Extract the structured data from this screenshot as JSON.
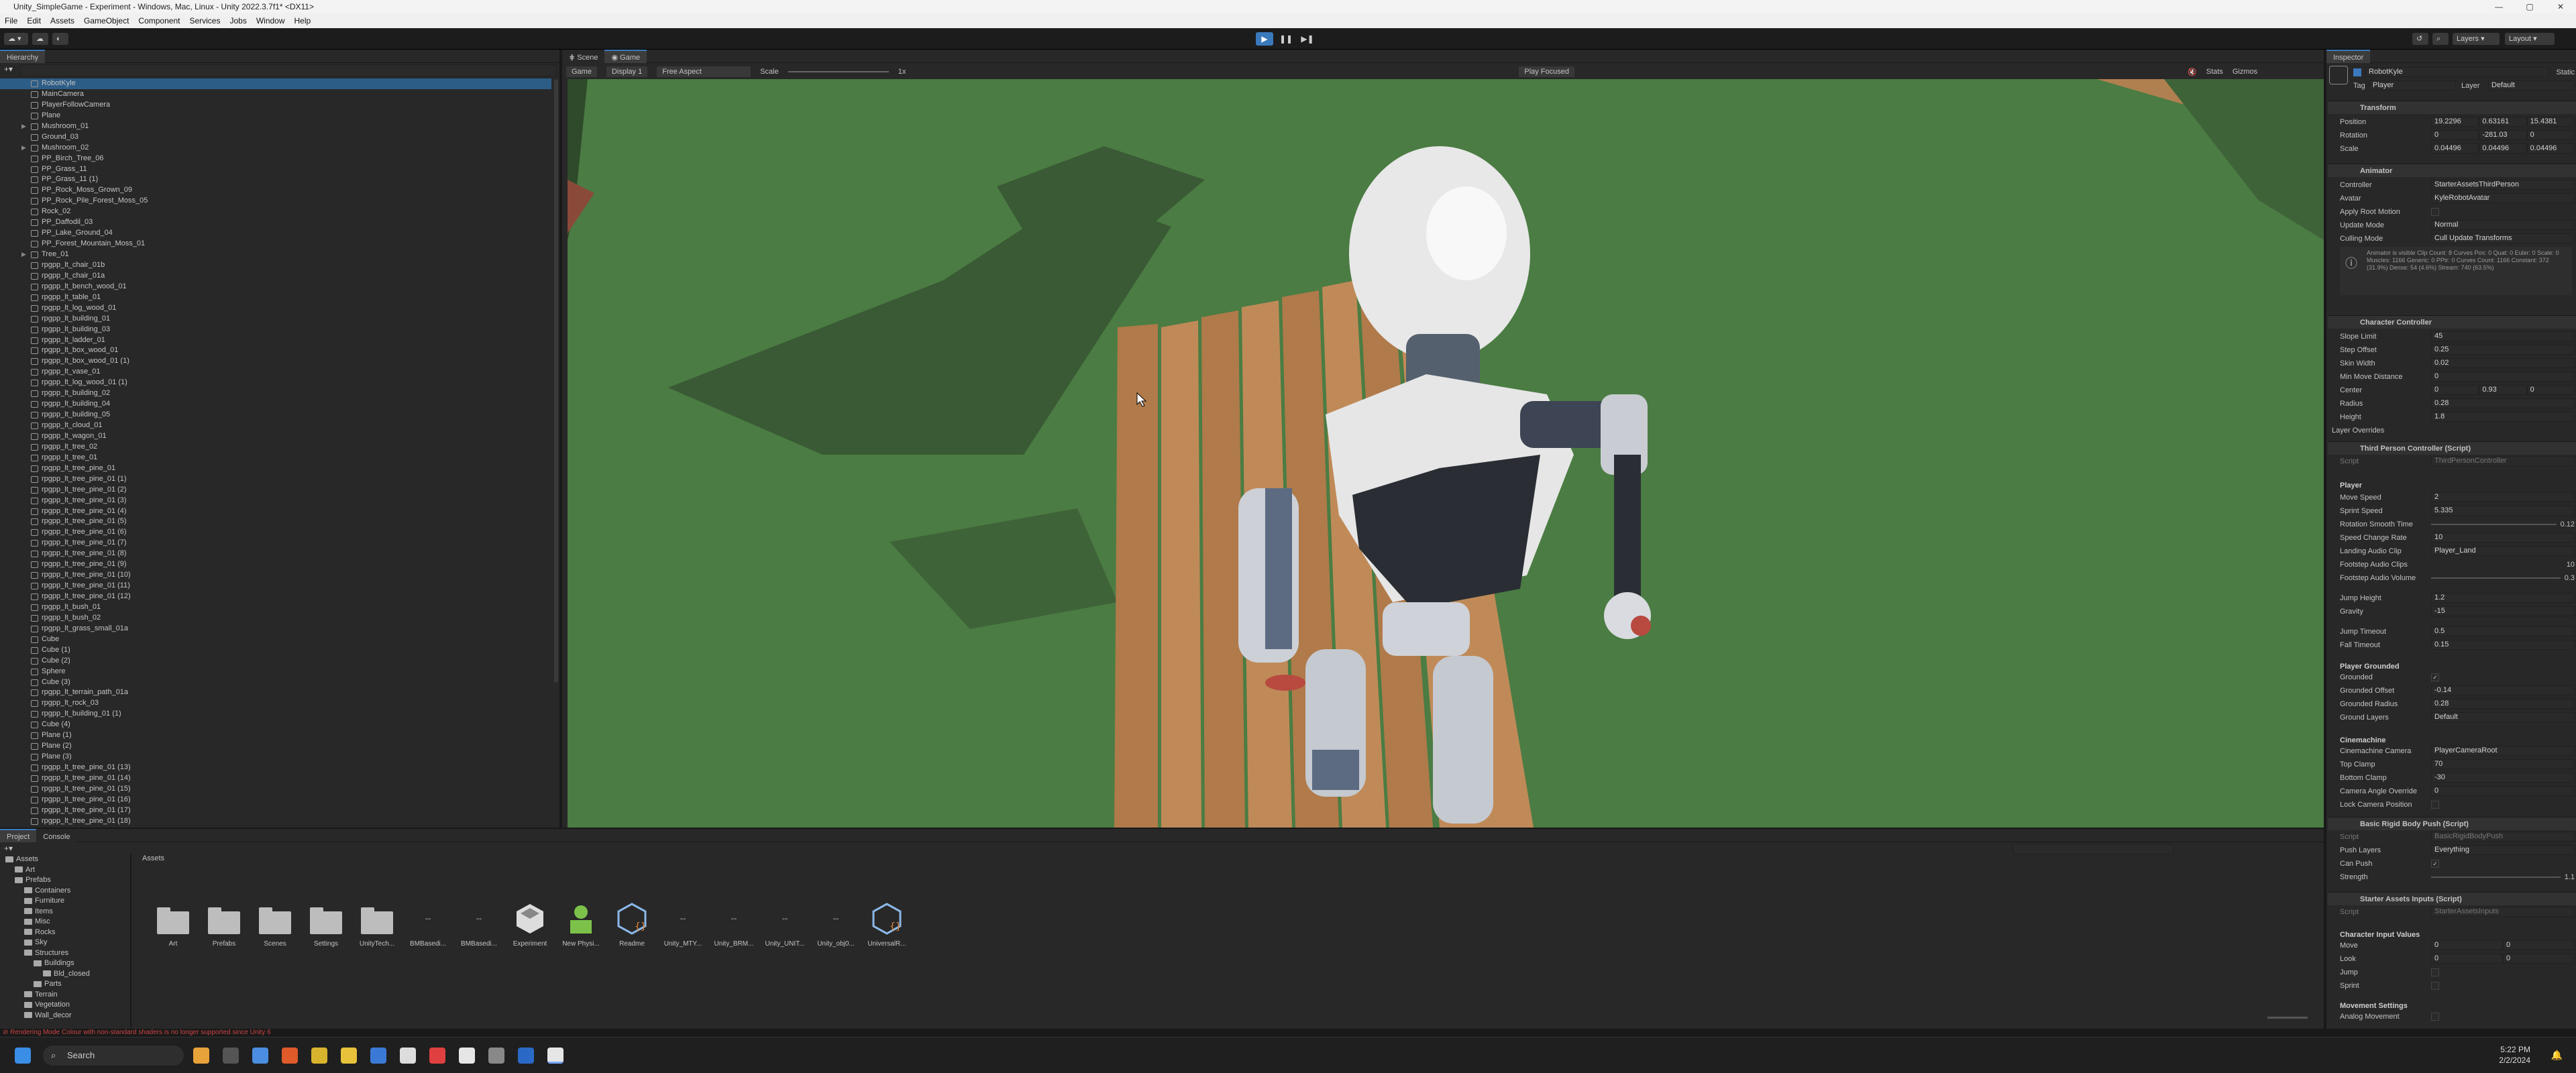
{
  "window": {
    "title": "Unity_SimpleGame - Experiment - Windows, Mac, Linux - Unity 2022.3.7f1* <DX11>",
    "controls": [
      "—",
      "▢",
      "✕"
    ]
  },
  "menu": [
    "File",
    "Edit",
    "Assets",
    "GameObject",
    "Component",
    "Services",
    "Jobs",
    "Window",
    "Help"
  ],
  "toolbar": {
    "layers": "Layers",
    "layout": "Layout"
  },
  "hierarchy": {
    "tab": "Hierarchy",
    "items": [
      "RobotKyle",
      "MainCamera",
      "PlayerFollowCamera",
      "Plane",
      "Mushroom_01",
      "Ground_03",
      "Mushroom_02",
      "PP_Birch_Tree_06",
      "PP_Grass_11",
      "PP_Grass_11 (1)",
      "PP_Rock_Moss_Grown_09",
      "PP_Rock_Pile_Forest_Moss_05",
      "Rock_02",
      "PP_Daffodil_03",
      "PP_Lake_Ground_04",
      "PP_Forest_Mountain_Moss_01",
      "Tree_01",
      "rpgpp_lt_chair_01b",
      "rpgpp_lt_chair_01a",
      "rpgpp_lt_bench_wood_01",
      "rpgpp_lt_table_01",
      "rpgpp_lt_log_wood_01",
      "rpgpp_lt_building_01",
      "rpgpp_lt_building_03",
      "rpgpp_lt_ladder_01",
      "rpgpp_lt_box_wood_01",
      "rpgpp_lt_box_wood_01 (1)",
      "rpgpp_lt_vase_01",
      "rpgpp_lt_log_wood_01 (1)",
      "rpgpp_lt_building_02",
      "rpgpp_lt_building_04",
      "rpgpp_lt_building_05",
      "rpgpp_lt_cloud_01",
      "rpgpp_lt_wagon_01",
      "rpgpp_lt_tree_02",
      "rpgpp_lt_tree_01",
      "rpgpp_lt_tree_pine_01",
      "rpgpp_lt_tree_pine_01 (1)",
      "rpgpp_lt_tree_pine_01 (2)",
      "rpgpp_lt_tree_pine_01 (3)",
      "rpgpp_lt_tree_pine_01 (4)",
      "rpgpp_lt_tree_pine_01 (5)",
      "rpgpp_lt_tree_pine_01 (6)",
      "rpgpp_lt_tree_pine_01 (7)",
      "rpgpp_lt_tree_pine_01 (8)",
      "rpgpp_lt_tree_pine_01 (9)",
      "rpgpp_lt_tree_pine_01 (10)",
      "rpgpp_lt_tree_pine_01 (11)",
      "rpgpp_lt_tree_pine_01 (12)",
      "rpgpp_lt_bush_01",
      "rpgpp_lt_bush_02",
      "rpgpp_lt_grass_small_01a",
      "Cube",
      "Cube (1)",
      "Cube (2)",
      "Sphere",
      "Cube (3)",
      "rpgpp_lt_terrain_path_01a",
      "rpgpp_lt_rock_03",
      "rpgpp_lt_building_01 (1)",
      "Cube (4)",
      "Plane (1)",
      "Plane (2)",
      "Plane (3)",
      "rpgpp_lt_tree_pine_01 (13)",
      "rpgpp_lt_tree_pine_01 (14)",
      "rpgpp_lt_tree_pine_01 (15)",
      "rpgpp_lt_tree_pine_01 (16)",
      "rpgpp_lt_tree_pine_01 (17)",
      "rpgpp_lt_tree_pine_01 (18)"
    ]
  },
  "scene": {
    "tabs": [
      "Scene",
      "Game"
    ],
    "game_dd": "Game",
    "display": "Display 1",
    "aspect": "Free Aspect",
    "scale_label": "Scale",
    "scale_value": "1x",
    "play_mode": "Play Focused",
    "stats": "Stats",
    "gizmos": "Gizmos"
  },
  "inspector": {
    "tab": "Inspector",
    "object": "RobotKyle",
    "static": "Static",
    "tag_label": "Tag",
    "tag": "Player",
    "layer_label": "Layer",
    "layer": "Default",
    "transform": {
      "title": "Transform",
      "position": [
        "19.2296",
        "0.63161",
        "15.4381"
      ],
      "rotation": [
        "0",
        "-281.03",
        "0"
      ],
      "scale": [
        "0.04496",
        "0.04496",
        "0.04496"
      ]
    },
    "animator": {
      "title": "Animator",
      "controller": "StarterAssetsThirdPerson",
      "avatar": "KyleRobotAvatar",
      "apply_root": "Apply Root Motion",
      "update_mode": "Normal",
      "culling": "Cull Update Transforms",
      "info": "Animator is visible  Clip Count: 8  Curves Pos: 0 Quat: 0 Euler: 0 Scale: 0 Muscles: 1166 Generic: 0 PPtr: 0  Curves Count: 1166 Constant: 372 (31.9%) Dense: 54 (4.6%) Stream: 740 (63.5%)"
    },
    "cc": {
      "title": "Character Controller",
      "slope": "45",
      "step": "0.25",
      "skin": "0.02",
      "minmove": "0",
      "center": [
        "0",
        "0.93",
        "0"
      ],
      "radius": "0.28",
      "height": "1.8",
      "overrides": "Layer Overrides"
    },
    "tpc": {
      "title": "Third Person Controller (Script)",
      "script": "ThirdPersonController",
      "player": "Player",
      "move": "2",
      "sprint": "5.335",
      "rot": "0.12",
      "speedchange": "10",
      "landing": "Player_Land",
      "footclips": "10",
      "footvol": "0.3",
      "jump": "1.2",
      "gravity": "-15",
      "jumptimeout": "0.5",
      "falltimeout": "0.15",
      "grounded_hdr": "Player Grounded",
      "goffset": "-0.14",
      "gradius": "0.28",
      "glayers": "Default",
      "cine": "Cinemachine",
      "cam": "PlayerCameraRoot",
      "topclamp": "70",
      "bottomclamp": "-30",
      "override": "0"
    },
    "brb": {
      "title": "Basic Rigid Body Push (Script)",
      "script": "BasicRigidBodyPush",
      "layers": "Everything",
      "strength": "1.1"
    },
    "sai": {
      "title": "Starter Assets Inputs (Script)",
      "script": "StarterAssetsInputs",
      "civ": "Character Input Values",
      "move": [
        "0",
        "0"
      ],
      "look": [
        "0",
        "0"
      ],
      "ms": "Movement Settings",
      "am": "Analog Movement"
    }
  },
  "labels": {
    "position": "Position",
    "rotation": "Rotation",
    "scale": "Scale",
    "controller": "Controller",
    "avatar": "Avatar",
    "update": "Update Mode",
    "culling": "Culling Mode",
    "slope": "Slope Limit",
    "step": "Step Offset",
    "skin": "Skin Width",
    "minmove": "Min Move Distance",
    "center": "Center",
    "radius": "Radius",
    "height": "Height",
    "script": "Script",
    "move": "Move Speed",
    "sprint": "Sprint Speed",
    "rot": "Rotation Smooth Time",
    "speedchange": "Speed Change Rate",
    "landing": "Landing Audio Clip",
    "footclips": "Footstep Audio Clips",
    "footvol": "Footstep Audio Volume",
    "jump": "Jump Height",
    "gravity": "Gravity",
    "jumptimeout": "Jump Timeout",
    "falltimeout": "Fall Timeout",
    "grounded": "Grounded",
    "goffset": "Grounded Offset",
    "gradius": "Grounded Radius",
    "glayers": "Ground Layers",
    "cam": "Cinemachine Camera",
    "topclamp": "Top Clamp",
    "bottomclamp": "Bottom Clamp",
    "override": "Camera Angle Override",
    "lock": "Lock Camera Position",
    "pushlayers": "Push Layers",
    "canpush": "Can Push",
    "strength": "Strength",
    "mv": "Move",
    "look": "Look",
    "jp": "Jump",
    "sp": "Sprint"
  },
  "project": {
    "tabs": [
      "Project",
      "Console"
    ],
    "breadcrumb": "Assets",
    "tree": [
      "Assets",
      "Art",
      "Prefabs",
      "Containers",
      "Furniture",
      "Items",
      "Misc",
      "Rocks",
      "Sky",
      "Structures",
      "Buildings",
      "Bld_closed",
      "Parts",
      "Terrain",
      "Vegetation",
      "Wall_decor"
    ],
    "assets": [
      "Art",
      "Prefabs",
      "Scenes",
      "Settings",
      "UnityTech...",
      "BMBasedi...",
      "BMBasedi...",
      "Experiment",
      "New Physi...",
      "Readme",
      "Unity_MTY...",
      "Unity_BRM...",
      "Unity_UNIT...",
      "Unity_obj0...",
      "UniversalR..."
    ],
    "slider_count": "15"
  },
  "status": {
    "error": "Rendering Mode Colour with non-standard shaders is no longer supported since Unity 6"
  },
  "taskbar": {
    "search": "Search",
    "time": "5:22 PM",
    "date": "2/2/2024"
  },
  "colors": {
    "accent": "#3a79bb",
    "ground": "#4a7a42",
    "wood": "#b8824f",
    "robot": "#e6e6e6"
  }
}
